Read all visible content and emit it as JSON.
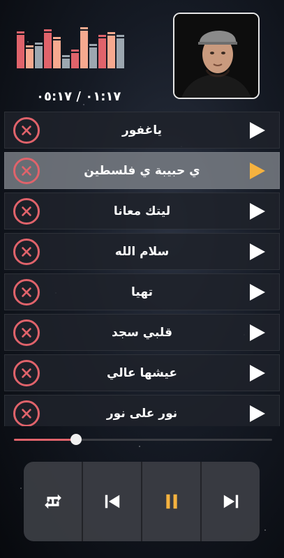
{
  "player": {
    "time_display": "٠١:١٧ / ٠٥:١٧",
    "progress": 0.24
  },
  "equalizer": {
    "colors": [
      "#e0636b",
      "#f6a98f",
      "#9ca7b0",
      "#e0636b",
      "#f6a98f",
      "#9ca7b0",
      "#e0636b",
      "#f6a98f",
      "#9ca7b0",
      "#e0636b",
      "#f6a98f",
      "#9ca7b0"
    ],
    "levels": [
      0.88,
      0.5,
      0.58,
      0.92,
      0.72,
      0.25,
      0.4,
      0.98,
      0.55,
      0.78,
      0.85,
      0.78
    ]
  },
  "playlist": {
    "songs": [
      {
        "title": "ياغفور"
      },
      {
        "title": "ي حبيبة ي فلسطين"
      },
      {
        "title": "ليتك معانا"
      },
      {
        "title": "سلام الله"
      },
      {
        "title": "تهيا"
      },
      {
        "title": "قلبي سجد"
      },
      {
        "title": "عيشها عالي"
      },
      {
        "title": "نور على نور"
      }
    ],
    "active_index": 1
  },
  "colors": {
    "accent": "#e0636b",
    "play_active": "#f5b23f",
    "play_idle": "#ffffff"
  },
  "controls": {
    "icons": [
      "repeat-one-icon",
      "previous-icon",
      "pause-icon",
      "next-icon"
    ]
  }
}
